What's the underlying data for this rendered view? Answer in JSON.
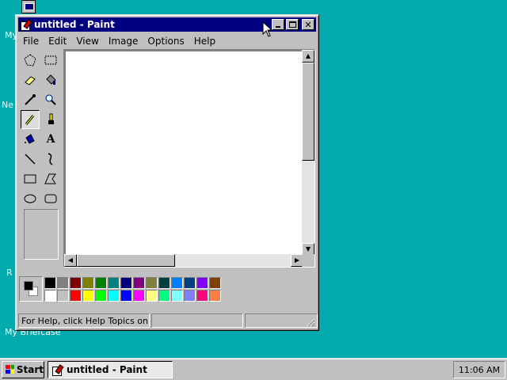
{
  "desktop": {
    "labels": [
      "My",
      "Ne",
      "R",
      "My Briefcase"
    ]
  },
  "window": {
    "title": "untitled - Paint",
    "buttons": {
      "minimize": "_",
      "maximize": "□",
      "close": "✕"
    }
  },
  "menu": [
    {
      "label": "File"
    },
    {
      "label": "Edit"
    },
    {
      "label": "View"
    },
    {
      "label": "Image"
    },
    {
      "label": "Options"
    },
    {
      "label": "Help"
    }
  ],
  "tools": [
    {
      "name": "free-form-select-icon"
    },
    {
      "name": "select-icon"
    },
    {
      "name": "eraser-icon"
    },
    {
      "name": "fill-icon"
    },
    {
      "name": "pick-color-icon"
    },
    {
      "name": "magnifier-icon"
    },
    {
      "name": "pencil-icon",
      "active": true
    },
    {
      "name": "brush-icon"
    },
    {
      "name": "airbrush-icon"
    },
    {
      "name": "text-icon",
      "glyph": "A"
    },
    {
      "name": "line-icon"
    },
    {
      "name": "curve-icon"
    },
    {
      "name": "rectangle-icon"
    },
    {
      "name": "polygon-icon"
    },
    {
      "name": "ellipse-icon"
    },
    {
      "name": "rounded-rectangle-icon"
    }
  ],
  "palette": {
    "foreground": "#000000",
    "background": "#ffffff",
    "row1": [
      "#000000",
      "#808080",
      "#800000",
      "#808000",
      "#008000",
      "#008080",
      "#000080",
      "#800080",
      "#808040",
      "#004040",
      "#0080ff",
      "#004080",
      "#8000ff",
      "#804000"
    ],
    "row2": [
      "#ffffff",
      "#c0c0c0",
      "#ff0000",
      "#ffff00",
      "#00ff00",
      "#00ffff",
      "#0000ff",
      "#ff00ff",
      "#ffff80",
      "#00ff80",
      "#80ffff",
      "#8080ff",
      "#ff0080",
      "#ff8040"
    ]
  },
  "status": {
    "help": "For Help, click Help Topics on the",
    "position": "",
    "size": ""
  },
  "taskbar": {
    "start": "Start",
    "task": "untitled - Paint",
    "clock": "11:06 AM"
  }
}
